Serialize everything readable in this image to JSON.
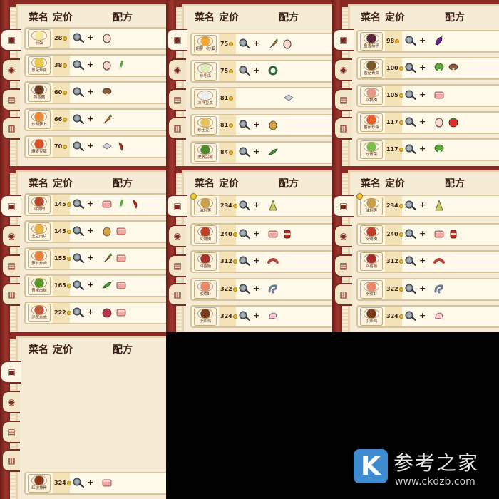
{
  "header": {
    "name": "菜名",
    "price": "定价",
    "recipe": "配方"
  },
  "tab_icons": [
    "fridge-icon",
    "ingredients-icon",
    "milk-icon",
    "sauce-icon"
  ],
  "panels": [
    {
      "rows": [
        {
          "name": "煎蛋",
          "price": "28",
          "dish_color": "#f7e8a0",
          "ings": [
            {
              "n": "egg-icon",
              "c": "#f7d9cf"
            }
          ],
          "badge": false
        },
        {
          "name": "葱花炒蛋",
          "price": "38",
          "dish_color": "#e9c54a",
          "ings": [
            {
              "n": "egg-icon",
              "c": "#f7d9cf"
            },
            {
              "n": "scallion-icon",
              "c": "#55a63a"
            }
          ],
          "badge": false
        },
        {
          "name": "煎香菇",
          "price": "60",
          "dish_color": "#6b3b24",
          "ings": [
            {
              "n": "mushroom-icon",
              "c": "#8a5a3c"
            }
          ],
          "badge": false
        },
        {
          "name": "炒胡萝卜",
          "price": "66",
          "dish_color": "#e98a3a",
          "ings": [
            {
              "n": "carrot-icon",
              "c": "#ec7a2a"
            }
          ],
          "badge": false
        },
        {
          "name": "麻婆豆腐",
          "price": "70",
          "dish_color": "#d9502a",
          "ings": [
            {
              "n": "tofu-icon",
              "c": "#cfd3d7"
            },
            {
              "n": "chili-icon",
              "c": "#c92a1a"
            }
          ],
          "badge": false
        }
      ]
    },
    {
      "rows": [
        {
          "name": "胡萝卜炒蛋",
          "price": "75",
          "dish_color": "#f0a83a",
          "ings": [
            {
              "n": "carrot-icon",
              "c": "#ec7a2a"
            },
            {
              "n": "egg-icon",
              "c": "#f7d9cf"
            }
          ],
          "badge": false
        },
        {
          "name": "炒冬瓜",
          "price": "75",
          "dish_color": "#dfe8b8",
          "ings": [
            {
              "n": "winter-melon-icon",
              "c": "#2f6b3a"
            }
          ],
          "badge": false
        },
        {
          "name": "凉拌豆腐",
          "price": "81",
          "dish_color": "#eeeeee",
          "ings": [
            {
              "n": "tofu-icon",
              "c": "#cfd3d7"
            }
          ],
          "badge": false
        },
        {
          "name": "炒土豆片",
          "price": "81",
          "dish_color": "#e8c25a",
          "ings": [
            {
              "n": "potato-icon",
              "c": "#d6a548"
            }
          ],
          "badge": false
        },
        {
          "name": "虎皮尖椒",
          "price": "84",
          "dish_color": "#4f8a2a",
          "ings": [
            {
              "n": "green-pepper-icon",
              "c": "#3f9a2a"
            }
          ],
          "badge": false
        }
      ]
    },
    {
      "rows": [
        {
          "name": "鱼香茄子",
          "price": "98",
          "dish_color": "#5a2a3a",
          "ings": [
            {
              "n": "eggplant-icon",
              "c": "#6a2a8a"
            }
          ],
          "badge": false
        },
        {
          "name": "香菇青菜",
          "price": "100",
          "dish_color": "#7a5a2a",
          "ings": [
            {
              "n": "bok-choy-icon",
              "c": "#5aa83a"
            },
            {
              "n": "mushroom-icon",
              "c": "#8a5a3c"
            }
          ],
          "badge": false
        },
        {
          "name": "回锅肉",
          "price": "105",
          "dish_color": "#e89a8a",
          "ings": [
            {
              "n": "pork-icon",
              "c": "#f0a8a0"
            }
          ],
          "badge": false
        },
        {
          "name": "番茄炒蛋",
          "price": "117",
          "dish_color": "#e8602a",
          "ings": [
            {
              "n": "egg-icon",
              "c": "#f7d9cf"
            },
            {
              "n": "tomato-icon",
              "c": "#d9302a"
            }
          ],
          "badge": false
        },
        {
          "name": "炒青菜",
          "price": "117",
          "dish_color": "#7ac04a",
          "ings": [
            {
              "n": "bok-choy-icon",
              "c": "#5aa83a"
            }
          ],
          "badge": false
        }
      ]
    },
    {
      "rows": [
        {
          "name": "回锅肉",
          "price": "145",
          "dish_color": "#b84a2a",
          "ings": [
            {
              "n": "pork-icon",
              "c": "#f0a8a0"
            },
            {
              "n": "scallion-icon",
              "c": "#55a63a"
            },
            {
              "n": "chili-icon",
              "c": "#c92a1a"
            }
          ],
          "badge": false
        },
        {
          "name": "土豆肉片",
          "price": "145",
          "dish_color": "#e8b24a",
          "ings": [
            {
              "n": "potato-icon",
              "c": "#d6a548"
            },
            {
              "n": "pork-icon",
              "c": "#f0a8a0"
            }
          ],
          "badge": false
        },
        {
          "name": "萝卜炒肉",
          "price": "155",
          "dish_color": "#e0803a",
          "ings": [
            {
              "n": "carrot-icon",
              "c": "#ec7a2a"
            },
            {
              "n": "pork-icon",
              "c": "#f0a8a0"
            }
          ],
          "badge": false
        },
        {
          "name": "青椒肉丝",
          "price": "165",
          "dish_color": "#5a9a2a",
          "ings": [
            {
              "n": "green-pepper-icon",
              "c": "#3f9a2a"
            },
            {
              "n": "pork-icon",
              "c": "#f0a8a0"
            }
          ],
          "badge": false
        },
        {
          "name": "洋葱炒肉",
          "price": "222",
          "dish_color": "#c05a3a",
          "ings": [
            {
              "n": "onion-icon",
              "c": "#b8324a"
            },
            {
              "n": "pork-icon",
              "c": "#f0a8a0"
            }
          ],
          "badge": false
        }
      ]
    },
    {
      "rows": [
        {
          "name": "油焖笋",
          "price": "234",
          "dish_color": "#c8a04a",
          "ings": [
            {
              "n": "bamboo-shoot-icon",
              "c": "#c9c86a"
            }
          ],
          "badge": true
        },
        {
          "name": "叉烧肉",
          "price": "240",
          "dish_color": "#c0402a",
          "ings": [
            {
              "n": "pork-icon",
              "c": "#f0a8a0"
            },
            {
              "n": "sauce-jar-icon",
              "c": "#c0302a"
            }
          ],
          "badge": false
        },
        {
          "name": "回香肠",
          "price": "312",
          "dish_color": "#a8302a",
          "ings": [
            {
              "n": "sausage-icon",
              "c": "#c0403a"
            }
          ],
          "badge": false
        },
        {
          "name": "水煮虾",
          "price": "322",
          "dish_color": "#e88a6a",
          "ings": [
            {
              "n": "shrimp-icon",
              "c": "#6a7a8a"
            }
          ],
          "badge": false
        },
        {
          "name": "小炒鸡",
          "price": "324",
          "dish_color": "#7a3a1a",
          "ings": [
            {
              "n": "chicken-icon",
              "c": "#f7c8d0"
            }
          ],
          "badge": false
        }
      ]
    },
    {
      "rows": [
        {
          "name": "油焖笋",
          "price": "234",
          "dish_color": "#c8a04a",
          "ings": [
            {
              "n": "bamboo-shoot-icon",
              "c": "#c9c86a"
            }
          ],
          "badge": true
        },
        {
          "name": "叉烧肉",
          "price": "240",
          "dish_color": "#c0402a",
          "ings": [
            {
              "n": "pork-icon",
              "c": "#f0a8a0"
            },
            {
              "n": "sauce-jar-icon",
              "c": "#c0302a"
            }
          ],
          "badge": false
        },
        {
          "name": "回香肠",
          "price": "312",
          "dish_color": "#a8302a",
          "ings": [
            {
              "n": "sausage-icon",
              "c": "#c0403a"
            }
          ],
          "badge": false
        },
        {
          "name": "水煮虾",
          "price": "322",
          "dish_color": "#e88a6a",
          "ings": [
            {
              "n": "shrimp-icon",
              "c": "#6a7a8a"
            }
          ],
          "badge": false
        },
        {
          "name": "小炒鸡",
          "price": "324",
          "dish_color": "#7a3a1a",
          "ings": [
            {
              "n": "chicken-icon",
              "c": "#f7c8d0"
            }
          ],
          "badge": false
        }
      ]
    },
    {
      "rows": [
        {
          "name": "红烧排骨",
          "price": "324",
          "dish_color": "#8a3a1a",
          "ings": [
            {
              "n": "ribs-icon",
              "c": "#f0a8a0"
            }
          ],
          "badge": false
        }
      ]
    }
  ],
  "watermark": {
    "logo": "K",
    "title": "参考之家",
    "url": "www.ckdzb.com"
  }
}
